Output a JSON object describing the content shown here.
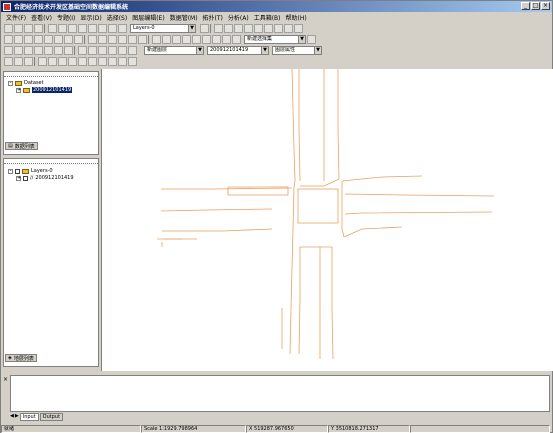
{
  "window": {
    "title": "合肥经济技术开发区基础空间数据编辑系统",
    "controls": [
      "_",
      "□",
      "×"
    ]
  },
  "menu": [
    "文件(F)",
    "查看(V)",
    "专题(I)",
    "显示(D)",
    "选择(S)",
    "图层编辑(E)",
    "数据管(M)",
    "拓扑(T)",
    "分析(A)",
    "工具箱(B)",
    "帮助(H)"
  ],
  "toolbar": {
    "layer_combo": "Layers-0",
    "new_selection_combo": "新建选择集",
    "layer_select_combo": "新建图层",
    "dataset_combo": "200912101419",
    "field_combo": "图层属性"
  },
  "dataset_panel": {
    "root_label": "Dataset",
    "child_label": "200912101419",
    "tab_label": "数据列表"
  },
  "layers_panel": {
    "root_label": "Layers-0",
    "child_label": "200912101419",
    "tab_label": "地层列表"
  },
  "output_panel": {
    "tabs": [
      "Input",
      "Output"
    ]
  },
  "status": {
    "state": "就绪",
    "scale": "Scale 1:1929.798964",
    "x": "X 519287.967650",
    "y": "Y 3510818.271317"
  },
  "colors": {
    "road_lines": "#e8a060",
    "selection": "#0a246a",
    "titlebar": "#0a246a"
  }
}
